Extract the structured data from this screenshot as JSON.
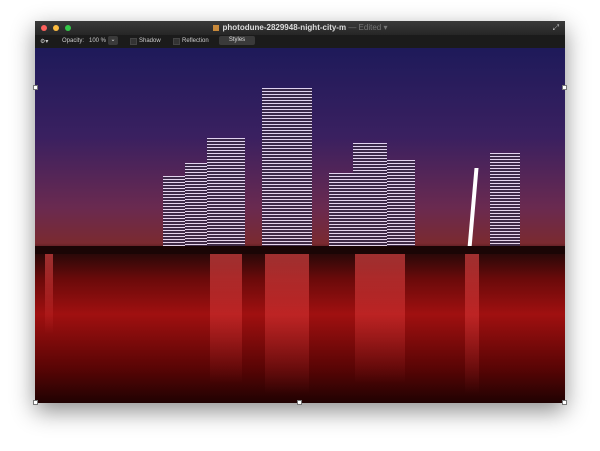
{
  "window": {
    "filename": "photodune-2829948-night-city-m",
    "status": "— Edited ▾",
    "expand_icon": "expand-icon"
  },
  "toolbar": {
    "gear": "⚙▾",
    "opacity_label": "Opacity:",
    "opacity_value": "100 %",
    "stepper": "⌄",
    "shadow_label": "Shadow",
    "reflection_label": "Reflection",
    "styles_label": "Styles"
  },
  "colors": {
    "close": "#fc605c",
    "minimize": "#fdbc40",
    "zoom": "#34c84a"
  }
}
